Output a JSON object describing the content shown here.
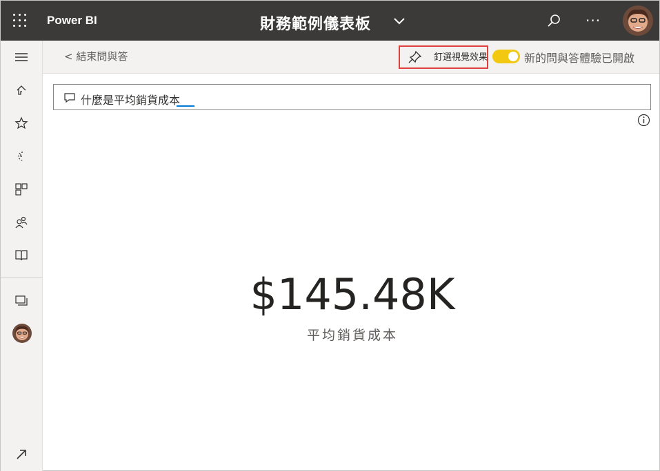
{
  "app": {
    "brand": "Power BI",
    "dashboard_title": "財務範例儀表板",
    "more_label": "···"
  },
  "leftnav": {
    "items": [
      {
        "name": "menu-icon"
      },
      {
        "name": "home-icon"
      },
      {
        "name": "favorites-star-icon"
      },
      {
        "name": "recent-clock-icon"
      },
      {
        "name": "apps-icon"
      },
      {
        "name": "shared-with-me-icon"
      },
      {
        "name": "learn-book-icon"
      },
      {
        "name": "workspaces-icon"
      },
      {
        "name": "expand-arrow-icon"
      }
    ]
  },
  "cmdbar": {
    "back_label": "< 結束問與答",
    "pin_label": "釘選視覺效果",
    "toggle_label": "新的問與答體驗已開啟",
    "toggle_on": true,
    "toggle_color": "#f2c811",
    "highlight_color": "#e0403c"
  },
  "qa": {
    "query": "什麼是平均銷貨成本"
  },
  "kpi": {
    "value": "$145.48K",
    "label": "平均銷貨成本"
  }
}
